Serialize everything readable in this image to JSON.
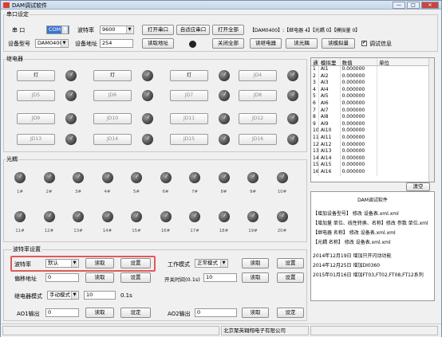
{
  "window": {
    "title": "DAM调试软件",
    "min": "—",
    "max": "□",
    "close": "✕"
  },
  "serial": {
    "group_title": "串口设定",
    "port_label": "串  口",
    "port_value": "COM1",
    "baud_label": "波特率",
    "baud_value": "9600",
    "model_label": "设备型号",
    "model_value": "DAM0400",
    "addr_label": "设备地址",
    "addr_value": "254",
    "open_btn": "打开串口",
    "auto_btn": "自适应串口",
    "open_all_btn": "打开全部",
    "read_addr_btn": "读取地址",
    "close_all_btn": "关闭全部",
    "read_relay_btn": "读继电器",
    "read_opto_btn": "读光耦",
    "read_analog_btn": "读模拟量",
    "info_line": "【DAM0400】:【继电器  4】【光耦  0】【模拟量  0】",
    "debug_label": "调试信息",
    "debug_checked": true
  },
  "relay": {
    "group_title": "继电器",
    "buttons": [
      "灯",
      "灯",
      "灯",
      "JD4",
      "JD5",
      "JD6",
      "JD7",
      "JD8",
      "JD9",
      "JD10",
      "JD11",
      "JD12",
      "JD13",
      "JD14",
      "JD15",
      "JD16"
    ]
  },
  "opto": {
    "group_title": "光耦",
    "labels": [
      "1#",
      "2#",
      "3#",
      "4#",
      "5#",
      "6#",
      "7#",
      "8#",
      "9#",
      "10#",
      "11#",
      "12#",
      "13#",
      "14#",
      "15#",
      "16#",
      "17#",
      "18#",
      "19#",
      "20#"
    ]
  },
  "table": {
    "headers": [
      "通",
      "模拟里",
      "数值",
      "单位"
    ],
    "rows": [
      [
        "1",
        "AI1",
        "0.000000",
        ""
      ],
      [
        "2",
        "AI2",
        "0.000000",
        ""
      ],
      [
        "3",
        "AI3",
        "0.000000",
        ""
      ],
      [
        "4",
        "AI4",
        "0.000000",
        ""
      ],
      [
        "5",
        "AI5",
        "0.000000",
        ""
      ],
      [
        "6",
        "AI6",
        "0.000000",
        ""
      ],
      [
        "7",
        "AI7",
        "0.000000",
        ""
      ],
      [
        "8",
        "AI8",
        "0.000000",
        ""
      ],
      [
        "9",
        "AI9",
        "0.000000",
        ""
      ],
      [
        "10",
        "AI10",
        "0.000000",
        ""
      ],
      [
        "11",
        "AI11",
        "0.000000",
        ""
      ],
      [
        "12",
        "AI12",
        "0.000000",
        ""
      ],
      [
        "13",
        "AI13",
        "0.000000",
        ""
      ],
      [
        "14",
        "AI14",
        "0.000000",
        ""
      ],
      [
        "15",
        "AI15",
        "0.000000",
        ""
      ],
      [
        "16",
        "AI16",
        "0.000000",
        ""
      ]
    ]
  },
  "clear_btn": "清空",
  "info_panel": {
    "title": "DAM调试软件",
    "lines": [
      "【增加设备型号】 修改  设备表.xml.xml",
      "【增加量  单位、线性转换、名称】修改 参数  单位.xml",
      "【继电器  名称】 修改  设备表.xml.xml",
      "【光耦  名称】 修改  设备表.xml.xml",
      "2014年12月19日   增加只开闪动功能",
      "2014年12月25日   增加DI0360",
      "2015年01月16日   增加FT03,FT02,FT08,FT12系列"
    ]
  },
  "baud_settings": {
    "group_title": "波特率设置",
    "baud_label": "波特率",
    "baud_value": "默认",
    "read_btn": "读取",
    "set_btn": "设置",
    "offset_label": "偏移地址",
    "offset_value": "0",
    "offset_read": "读取",
    "offset_set": "设置",
    "mode_label": "工作模式",
    "mode_value": "正常模式",
    "mode_read": "读取",
    "mode_set": "设置",
    "delay_label": "开关时间(0.1s)",
    "delay_value": "10",
    "delay_read": "读取",
    "delay_set": "设置",
    "relay_mode_label": "继电器模式",
    "relay_mode_value": "手动模式",
    "relay_time_value": "10",
    "relay_time_unit": "0.1s",
    "ao1_label": "AO1输出",
    "ao1_value": "0",
    "ao1_read": "读取",
    "ao1_set": "设定",
    "ao2_label": "AO2输出",
    "ao2_value": "0",
    "ao2_read": "读取",
    "ao2_set": "设定"
  },
  "status": {
    "cell1": "",
    "cell2": "北京聚英翱翔电子有限公司",
    "cell3": ""
  }
}
